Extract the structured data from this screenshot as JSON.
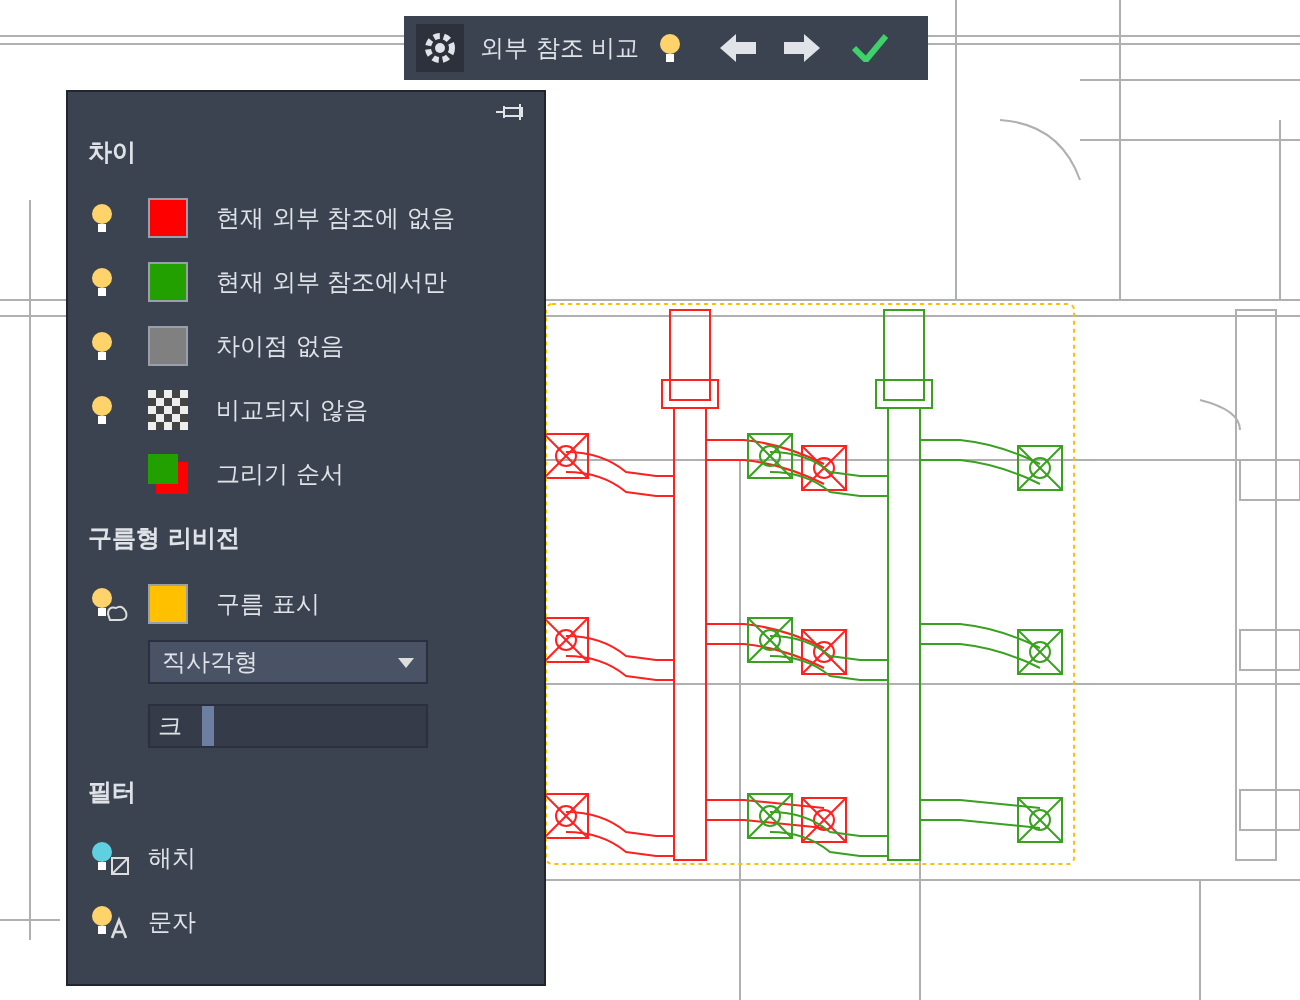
{
  "toolbar": {
    "title": "외부 참조 비교"
  },
  "differences": {
    "heading": "차이",
    "items": [
      {
        "label": "현재 외부 참조에 없음",
        "kind": "swatch",
        "color": "#ff0000",
        "visible": true
      },
      {
        "label": "현재 외부 참조에서만",
        "kind": "swatch",
        "color": "#22a000",
        "visible": true
      },
      {
        "label": "차이점 없음",
        "kind": "swatch",
        "color": "#808080",
        "visible": true
      },
      {
        "label": "비교되지 않음",
        "kind": "checker",
        "visible": true
      },
      {
        "label": "그리기 순서",
        "kind": "order"
      }
    ]
  },
  "revision_clouds": {
    "heading": "구름형 리비전",
    "show": {
      "label": "구름 표시",
      "color": "#ffc000"
    },
    "shape": {
      "value": "직사각형"
    },
    "size": {
      "label": "크",
      "level": 0.15
    }
  },
  "filter": {
    "heading": "필터",
    "items": [
      {
        "label": "해치",
        "kind": "hatch",
        "color": "#5fd0e0"
      },
      {
        "label": "문자",
        "kind": "text",
        "color": "#ffd36b"
      }
    ]
  }
}
